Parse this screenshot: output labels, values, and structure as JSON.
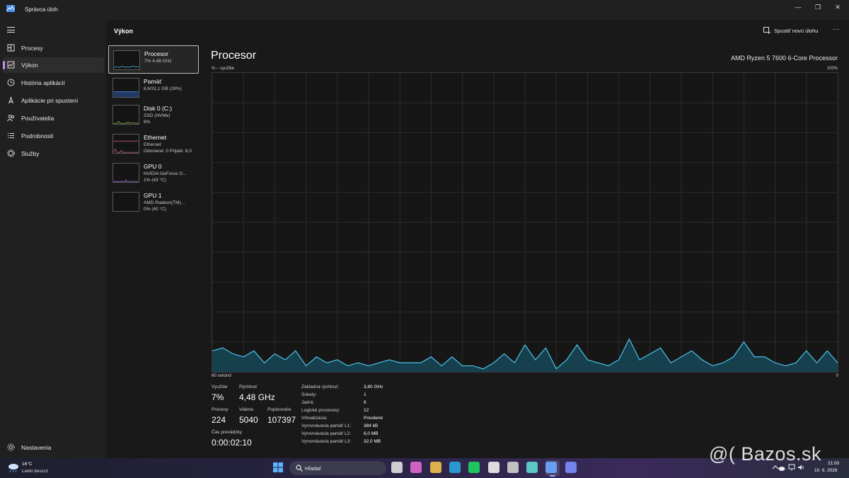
{
  "window": {
    "title": "Správca úloh",
    "controls": [
      "—",
      "❐",
      "✕"
    ]
  },
  "sidebar": {
    "items": [
      {
        "label": "Procesy",
        "icon": "processes-icon"
      },
      {
        "label": "Výkon",
        "icon": "performance-icon",
        "active": true
      },
      {
        "label": "História aplikácií",
        "icon": "history-icon"
      },
      {
        "label": "Aplikácie pri spustení",
        "icon": "startup-icon"
      },
      {
        "label": "Používatelia",
        "icon": "users-icon"
      },
      {
        "label": "Podrobnosti",
        "icon": "details-icon"
      },
      {
        "label": "Služby",
        "icon": "services-icon"
      }
    ],
    "settings_label": "Nastavenia"
  },
  "header": {
    "title": "Výkon",
    "new_task_label": "Spustiť novú úlohu",
    "more": "···"
  },
  "perf_list": [
    {
      "name": "Procesor",
      "sub1": "7% 4,48 GHz",
      "sub2": "",
      "color": "#4cc2e8",
      "selected": true
    },
    {
      "name": "Pamäť",
      "sub1": "8,6/31,1 GB (28%)",
      "sub2": "",
      "color": "#5b8fe8"
    },
    {
      "name": "Disk 0 (C:)",
      "sub1": "SSD (NVMe)",
      "sub2": "6%",
      "color": "#8fc04a"
    },
    {
      "name": "Ethernet",
      "sub1": "Ethernet",
      "sub2": "Odoslané: 0 Prijaté: 8,0",
      "color": "#d0648a"
    },
    {
      "name": "GPU 0",
      "sub1": "NVIDIA GeForce G...",
      "sub2": "1% (43 °C)",
      "color": "#9b6fd8"
    },
    {
      "name": "GPU 1",
      "sub1": "AMD Radeon(TM)...",
      "sub2": "0% (40 °C)",
      "color": "#9b6fd8"
    }
  ],
  "detail": {
    "title": "Procesor",
    "cpu_name": "AMD Ryzen 5 7600 6-Core Processor",
    "axis_top_left": "% – využitie",
    "axis_top_right": "100%",
    "axis_bottom_left": "60 sekúnd",
    "axis_bottom_right": "0",
    "graph_color": "#4cc2e8",
    "utilization_history": [
      7,
      8,
      6,
      5,
      7,
      3,
      6,
      4,
      7,
      2,
      5,
      3,
      4,
      2,
      3,
      2,
      3,
      4,
      3,
      3,
      3,
      5,
      2,
      5,
      2,
      2,
      1,
      3,
      6,
      3,
      9,
      4,
      8,
      1,
      4,
      9,
      4,
      3,
      2,
      4,
      11,
      4,
      6,
      8,
      3,
      5,
      7,
      4,
      2,
      3,
      5,
      10,
      5,
      5,
      3,
      2,
      3,
      7,
      3,
      7,
      3
    ],
    "stats": {
      "utilization_label": "Využitie",
      "utilization": "7%",
      "speed_label": "Rýchlosť",
      "speed": "4,48 GHz",
      "processes_label": "Procesy",
      "processes": "224",
      "threads_label": "Vlákna",
      "threads": "5040",
      "handles_label": "Popisovače",
      "handles": "107397",
      "uptime_label": "Čas prevádzky",
      "uptime": "0:00:02:10"
    },
    "info": [
      {
        "key": "Základná rýchlosť:",
        "value": "3,80 GHz"
      },
      {
        "key": "Sokety:",
        "value": "1"
      },
      {
        "key": "Jadrá:",
        "value": "6"
      },
      {
        "key": "Logické procesory:",
        "value": "12"
      },
      {
        "key": "Virtualizácia:",
        "value": "Povolené"
      },
      {
        "key": "Vyrovnávacia pamäť L1:",
        "value": "384 kB"
      },
      {
        "key": "Vyrovnávacia pamäť L2:",
        "value": "6,0 MB"
      },
      {
        "key": "Vyrovnávacia pamäť L3:",
        "value": "32,0 MB"
      }
    ]
  },
  "taskbar": {
    "weather_temp": "16°C",
    "weather_desc": "Lekki deszcz",
    "search_label": "Hľadať",
    "clock_time": "21:00",
    "clock_date": "10. 6. 2026",
    "apps": [
      {
        "icon": "file-explorer-icon",
        "color": "#e0e0e0"
      },
      {
        "icon": "copilot-icon",
        "color": "#e06ad0"
      },
      {
        "icon": "folder-icon",
        "color": "#f2c14e"
      },
      {
        "icon": "edge-icon",
        "color": "#2aa6e0"
      },
      {
        "icon": "spotify-icon",
        "color": "#1ed760"
      },
      {
        "icon": "store-icon",
        "color": "#f0f0f0"
      },
      {
        "icon": "obs-icon",
        "color": "#d0d0d0"
      },
      {
        "icon": "app-icon",
        "color": "#5fd8d0"
      },
      {
        "icon": "task-manager-icon",
        "color": "#6aa8ff"
      },
      {
        "icon": "discord-icon",
        "color": "#7b8cff"
      }
    ]
  },
  "watermark": "@( Bazos.sk"
}
